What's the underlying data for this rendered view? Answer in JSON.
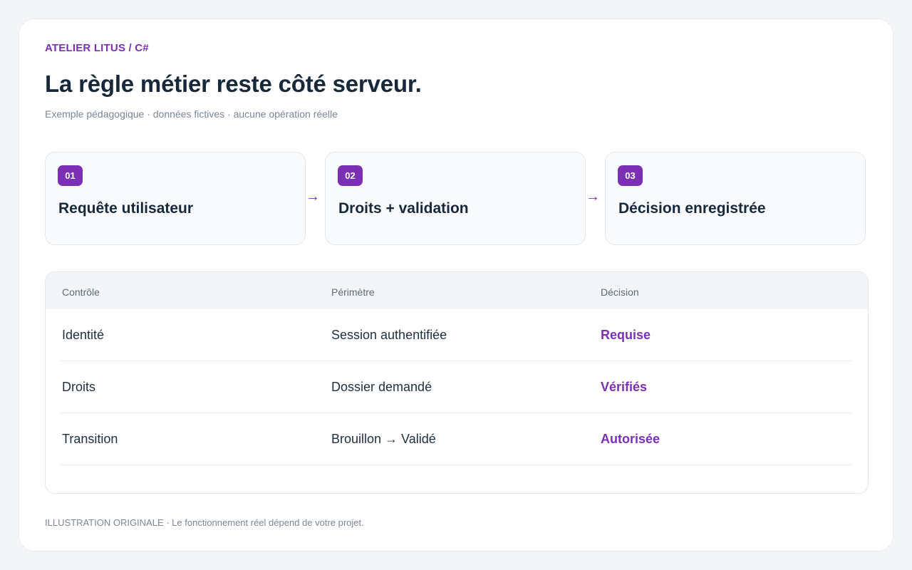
{
  "header": {
    "eyebrow": "ATELIER LITUS / C#",
    "title": "La règle métier reste côté serveur.",
    "subtitle": "Exemple pédagogique · données fictives · aucune opération réelle"
  },
  "steps": [
    {
      "number": "01",
      "label": "Requête utilisateur"
    },
    {
      "number": "02",
      "label": "Droits + validation"
    },
    {
      "number": "03",
      "label": "Décision enregistrée"
    }
  ],
  "arrow_glyph": "→",
  "table": {
    "headers": [
      "Contrôle",
      "Périmètre",
      "Décision"
    ],
    "rows": [
      [
        "Identité",
        "Session authentifiée",
        "Requise"
      ],
      [
        "Droits",
        "Dossier demandé",
        "Vérifiés"
      ],
      [
        "Transition",
        "Brouillon → Validé",
        "Autorisée"
      ]
    ]
  },
  "footer": "ILLUSTRATION ORIGINALE · Le fonctionnement réel dépend de votre projet.",
  "colors": {
    "accent": "#7b2fb5",
    "background": "#f3f5f7",
    "card": "#ffffff",
    "text": "#17283a"
  }
}
